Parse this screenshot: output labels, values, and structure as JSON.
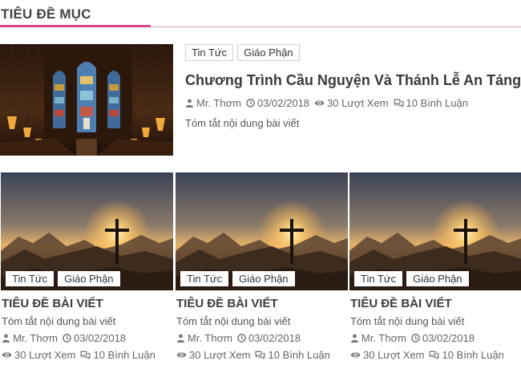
{
  "section": {
    "title": "TIÊU ĐỀ MỤC"
  },
  "featured": {
    "tags": [
      "Tin Tức",
      "Giáo Phận"
    ],
    "title": "Chương Trình Cầu Nguyện Và Thánh Lễ An Táng",
    "author": "Mr. Thơm",
    "date": "03/02/2018",
    "views": "30 Lượt Xem",
    "comments": "10 Bình Luận",
    "excerpt": "Tóm tắt nội dung bài viết"
  },
  "cards": [
    {
      "tags": [
        "Tin Tức",
        "Giáo Phận"
      ],
      "title": "TIÊU ĐỀ BÀI VIẾT",
      "excerpt": "Tóm tắt nội dung bài viết",
      "author": "Mr. Thơm",
      "date": "03/02/2018",
      "views": "30 Lượt Xem",
      "comments": "10 Bình Luận"
    },
    {
      "tags": [
        "Tin Tức",
        "Giáo Phận"
      ],
      "title": "TIÊU ĐỀ BÀI VIẾT",
      "excerpt": "Tóm tắt nội dung bài viết",
      "author": "Mr. Thơm",
      "date": "03/02/2018",
      "views": "30 Lượt Xem",
      "comments": "10 Bình Luận"
    },
    {
      "tags": [
        "Tin Tức",
        "Giáo Phận"
      ],
      "title": "TIÊU ĐỀ BÀI VIẾT",
      "excerpt": "Tóm tắt nội dung bài viết",
      "author": "Mr. Thơm",
      "date": "03/02/2018",
      "views": "30 Lượt Xem",
      "comments": "10 Bình Luận"
    }
  ],
  "colors": {
    "accent": "#d4468b",
    "title": "#3a3a3a",
    "meta": "#666666"
  },
  "icons": {
    "author": "user-icon",
    "date": "clock-icon",
    "views": "eye-icon",
    "comments": "comments-icon"
  }
}
